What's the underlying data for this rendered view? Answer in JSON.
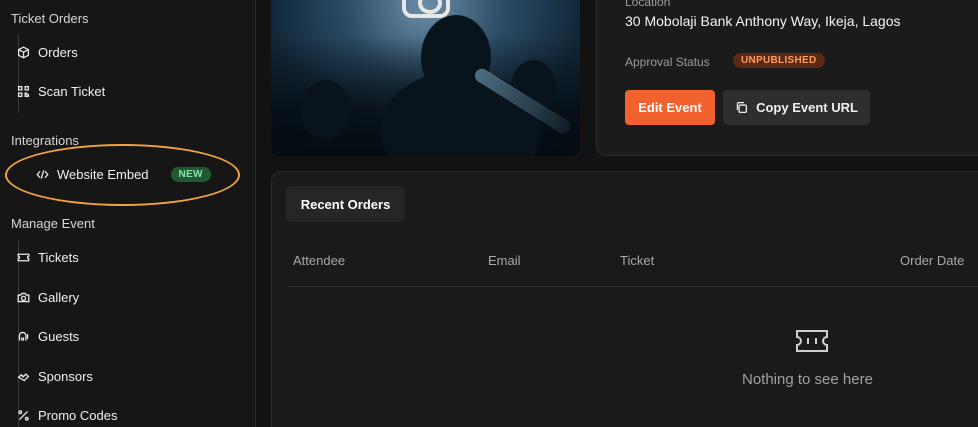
{
  "sidebar": {
    "sections": [
      {
        "title": "Ticket Orders",
        "items": [
          {
            "label": "Orders",
            "icon": "box-icon"
          },
          {
            "label": "Scan Ticket",
            "icon": "qr-code-icon"
          }
        ]
      },
      {
        "title": "Integrations",
        "items": [
          {
            "label": "Website Embed",
            "icon": "code-icon",
            "badge": "NEW"
          }
        ]
      },
      {
        "title": "Manage Event",
        "items": [
          {
            "label": "Tickets",
            "icon": "ticket-icon"
          },
          {
            "label": "Gallery",
            "icon": "camera-icon"
          },
          {
            "label": "Guests",
            "icon": "guests-icon"
          },
          {
            "label": "Sponsors",
            "icon": "sponsors-icon"
          },
          {
            "label": "Promo Codes",
            "icon": "percent-icon"
          }
        ]
      }
    ]
  },
  "event": {
    "location_label": "Location",
    "location_value": "30 Mobolaji Bank Anthony Way, Ikeja, Lagos",
    "approval_label": "Approval Status",
    "approval_value": "UNPUBLISHED",
    "edit_button": "Edit Event",
    "copy_button": "Copy Event URL"
  },
  "orders": {
    "tab_label": "Recent Orders",
    "columns": [
      "Attendee",
      "Email",
      "Ticket",
      "Order Date"
    ],
    "empty_text": "Nothing to see here"
  },
  "colors": {
    "accent": "#f2622e",
    "highlight": "#f0a340",
    "new_badge": "#1f5a35",
    "unpublished_badge": "#5a2a14"
  }
}
